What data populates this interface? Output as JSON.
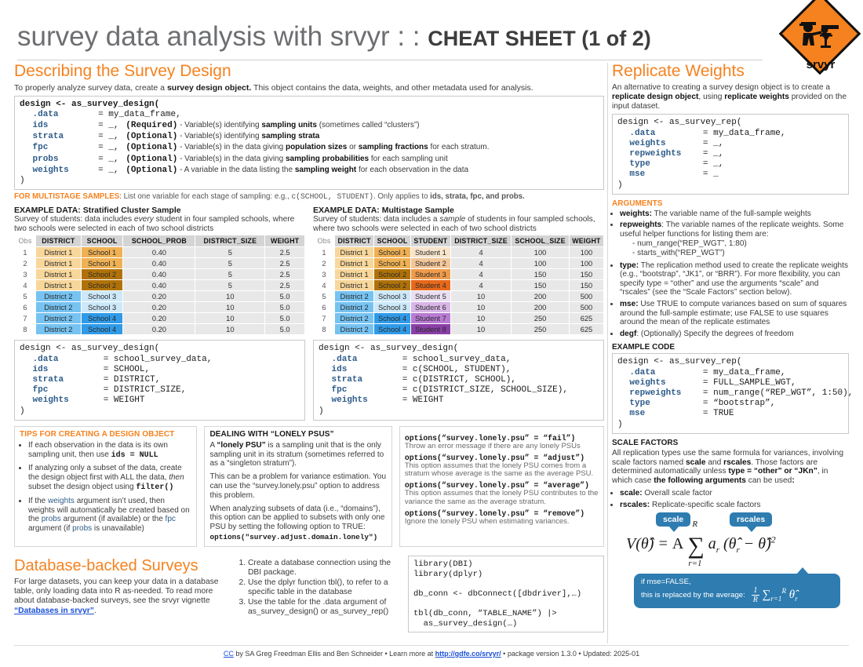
{
  "header": {
    "title_main": "survey data analysis with srvyr : : ",
    "title_bold": "CHEAT SHEET (1 of 2)",
    "logo_text": "srvyr",
    "logo_icon": "surveyor-transit-icon"
  },
  "design_section": {
    "heading": "Describing the Survey Design",
    "intro_a": "To properly analyze survey data, create a ",
    "intro_b": "survey design object.",
    "intro_c": " This object contains the data, weights, and other metadata used for analysis.",
    "code": {
      "line0": "design <- as_survey_design(",
      "rows": [
        {
          "arg": ".data",
          "eq": "= my_data_frame,",
          "req": "",
          "desc": ""
        },
        {
          "arg": "ids",
          "eq": "= _,",
          "req": "(Required)",
          "desc": " - Variable(s) identifying ",
          "b1": "sampling units",
          "tail": " (sometimes called “clusters”)"
        },
        {
          "arg": "strata",
          "eq": "= _,",
          "req": "(Optional)",
          "desc": " - Variable(s) identifying ",
          "b1": "sampling strata",
          "tail": ""
        },
        {
          "arg": "fpc",
          "eq": "= _,",
          "req": "(Optional)",
          "desc": " - Variable(s) in the data giving ",
          "b1": "population sizes",
          "mid": " or ",
          "b2": "sampling fractions",
          "tail": " for each stratum."
        },
        {
          "arg": "probs",
          "eq": "= _,",
          "req": "(Optional)",
          "desc": " - Variable(s) in the data giving ",
          "b1": "sampling probabilities",
          "tail": " for each sampling unit"
        },
        {
          "arg": "weights",
          "eq": "= _,",
          "req": "(Optional)",
          "desc": " - A variable in the data listing the ",
          "b1": "sampling weight",
          "tail": " for each observation in the data"
        }
      ],
      "close": ")"
    },
    "multistage_label": "FOR MULTISTAGE SAMPLES",
    "multistage_text_a": ": List one variable for each stage of sampling: e.g., ",
    "multistage_code": "c(SCHOOL, STUDENT)",
    "multistage_text_b": ". Only applies to ",
    "multistage_args": "ids, strata, fpc, and probs."
  },
  "example_stratified": {
    "heading_a": "EXAMPLE DATA: ",
    "heading_b": "Stratified Cluster Sample",
    "sub_a": "Survey of students: data includes ",
    "sub_i": "every",
    "sub_b": " student in four sampled schools, where two schools were selected in each of two school districts",
    "columns": [
      "Obs",
      "DISTRICT",
      "SCHOOL",
      "SCHOOL_PROB",
      "DISTRICT_SIZE",
      "WEIGHT"
    ],
    "rows": [
      {
        "obs": "1",
        "district": "District 1",
        "school": "School 1",
        "school_prob": "0.40",
        "district_size": "5",
        "weight": "2.5",
        "d_color": "#F8D79B",
        "s_color": "#EFB153"
      },
      {
        "obs": "2",
        "district": "District 1",
        "school": "School 1",
        "school_prob": "0.40",
        "district_size": "5",
        "weight": "2.5",
        "d_color": "#F8D79B",
        "s_color": "#EFB153"
      },
      {
        "obs": "3",
        "district": "District 1",
        "school": "School 2",
        "school_prob": "0.40",
        "district_size": "5",
        "weight": "2.5",
        "d_color": "#F8D79B",
        "s_color": "#B07208"
      },
      {
        "obs": "4",
        "district": "District 1",
        "school": "School 2",
        "school_prob": "0.40",
        "district_size": "5",
        "weight": "2.5",
        "d_color": "#F8D79B",
        "s_color": "#B07208"
      },
      {
        "obs": "5",
        "district": "District 2",
        "school": "School 3",
        "school_prob": "0.20",
        "district_size": "10",
        "weight": "5.0",
        "d_color": "#76C3F2",
        "s_color": "#CCE8F9"
      },
      {
        "obs": "6",
        "district": "District 2",
        "school": "School 3",
        "school_prob": "0.20",
        "district_size": "10",
        "weight": "5.0",
        "d_color": "#76C3F2",
        "s_color": "#CCE8F9"
      },
      {
        "obs": "7",
        "district": "District 2",
        "school": "School 4",
        "school_prob": "0.20",
        "district_size": "10",
        "weight": "5.0",
        "d_color": "#76C3F2",
        "s_color": "#2F9BE8"
      },
      {
        "obs": "8",
        "district": "District 2",
        "school": "School 4",
        "school_prob": "0.20",
        "district_size": "10",
        "weight": "5.0",
        "d_color": "#76C3F2",
        "s_color": "#2F9BE8"
      }
    ],
    "code": {
      "line0": "design <- as_survey_design(",
      "rows": [
        {
          "arg": ".data",
          "val": "= school_survey_data,"
        },
        {
          "arg": "ids",
          "val": "= SCHOOL,"
        },
        {
          "arg": "strata",
          "val": "= DISTRICT,"
        },
        {
          "arg": "fpc",
          "val": "= DISTRICT_SIZE,"
        },
        {
          "arg": "weights",
          "val": "= WEIGHT"
        }
      ],
      "close": ")"
    }
  },
  "example_multistage": {
    "heading_a": "EXAMPLE DATA: ",
    "heading_b": "Multistage Sample",
    "sub_a": "Survey of students: data includes a ",
    "sub_i": "sample",
    "sub_b": " of students in four sampled schools, where two schools were selected in each of two school districts",
    "columns": [
      "Obs",
      "DISTRICT",
      "SCHOOL",
      "STUDENT",
      "DISTRICT_SIZE",
      "SCHOOL_SIZE",
      "WEIGHT"
    ],
    "rows": [
      {
        "obs": "1",
        "district": "District 1",
        "school": "School 1",
        "student": "Student 1",
        "district_size": "4",
        "school_size": "100",
        "weight": "100",
        "d_color": "#F8D79B",
        "s_color": "#EFB153",
        "t_color": "#F7E4CB"
      },
      {
        "obs": "2",
        "district": "District 1",
        "school": "School 1",
        "student": "Student 2",
        "district_size": "4",
        "school_size": "100",
        "weight": "100",
        "d_color": "#F8D79B",
        "s_color": "#EFB153",
        "t_color": "#F3C79A"
      },
      {
        "obs": "3",
        "district": "District 1",
        "school": "School 2",
        "student": "Student 3",
        "district_size": "4",
        "school_size": "150",
        "weight": "150",
        "d_color": "#F8D79B",
        "s_color": "#B07208",
        "t_color": "#F09B4A"
      },
      {
        "obs": "4",
        "district": "District 1",
        "school": "School 2",
        "student": "Student 4",
        "district_size": "4",
        "school_size": "150",
        "weight": "150",
        "d_color": "#F8D79B",
        "s_color": "#B07208",
        "t_color": "#E8681A"
      },
      {
        "obs": "5",
        "district": "District 2",
        "school": "School 3",
        "student": "Student 5",
        "district_size": "10",
        "school_size": "200",
        "weight": "500",
        "d_color": "#76C3F2",
        "s_color": "#CCE8F9",
        "t_color": "#EADEF2"
      },
      {
        "obs": "6",
        "district": "District 2",
        "school": "School 3",
        "student": "Student 6",
        "district_size": "10",
        "school_size": "200",
        "weight": "500",
        "d_color": "#76C3F2",
        "s_color": "#CCE8F9",
        "t_color": "#D9B6E8"
      },
      {
        "obs": "7",
        "district": "District 2",
        "school": "School 4",
        "student": "Student 7",
        "district_size": "10",
        "school_size": "250",
        "weight": "625",
        "d_color": "#76C3F2",
        "s_color": "#2F9BE8",
        "t_color": "#B97AD4"
      },
      {
        "obs": "8",
        "district": "District 2",
        "school": "School 4",
        "student": "Student 8",
        "district_size": "10",
        "school_size": "250",
        "weight": "625",
        "d_color": "#76C3F2",
        "s_color": "#2F9BE8",
        "t_color": "#8B3FA8"
      }
    ],
    "code": {
      "line0": "design <- as_survey_design(",
      "rows": [
        {
          "arg": ".data",
          "val": "= school_survey_data,"
        },
        {
          "arg": "ids",
          "val": "= c(SCHOOL, STUDENT),"
        },
        {
          "arg": "strata",
          "val": "= c(DISTRICT, SCHOOL),"
        },
        {
          "arg": "fpc",
          "val": "= c(DISTRICT_SIZE, SCHOOL_SIZE),"
        },
        {
          "arg": "weights",
          "val": "= WEIGHT"
        }
      ],
      "close": ")"
    }
  },
  "tips": {
    "heading": "TIPS FOR CREATING A DESIGN OBJECT",
    "items": [
      {
        "a": "If each observation in the data is its own sampling unit, then use ",
        "code": "ids = NULL",
        "b": ""
      },
      {
        "a": "If analyzing only a subset of the data, create the design object first with ALL the data, ",
        "i": "then",
        "b2": " subset the design object using ",
        "code": "filter()"
      },
      {
        "a2": "If the ",
        "blue1": "weights",
        "mid1": " argument isn’t used, then weights will automatically be created based on the ",
        "blue2": "probs",
        "mid2": " argument (if available) or the ",
        "blue3": "fpc",
        "mid3": " argument (if ",
        "blue4": "probs",
        "mid4": " is unavailable)"
      }
    ]
  },
  "lonely": {
    "heading": "DEALING WITH “LONELY PSUS”",
    "p1_a": "A ",
    "p1_b": "“lonely PSU”",
    "p1_c": " is a sampling unit that is the only sampling unit in its stratum (sometimes referred to as a “singleton stratum”).",
    "p2": "This can be a problem for variance estimation. You can use the “survey.lonely.psu” option to address this problem.",
    "p3": "When analyzing subsets of data (i.e., “domains”), this option can be applied to subsets with only one PSU by setting the following option to TRUE:",
    "p3_code": "options(\"survey.adjust.domain.lonely\")",
    "options": [
      {
        "code": "options(“survey.lonely.psu” = “fail”)",
        "desc": "Throw an error message if there are any lonely PSUs"
      },
      {
        "code": "options(“survey.lonely.psu” = “adjust”)",
        "desc": "This option assumes that the lonely PSU comes from a stratum whose average is the same as the average PSU."
      },
      {
        "code": "options(“survey.lonely.psu” = “average”)",
        "desc": "This option assumes that the lonely PSU contributes to the variance the same as the average stratum."
      },
      {
        "code": "options(“survey.lonely.psu” = “remove”)",
        "desc": "Ignore the lonely PSU when estimating variances."
      }
    ]
  },
  "database": {
    "heading": "Database-backed Surveys",
    "text_a": "For large datasets, you can keep your data in a database table, only loading data into R as-needed. To read more about database-backed surveys, see the srvyr vignette ",
    "link": "“Databases in srvyr”",
    "text_b": ".",
    "steps": [
      "Create a database connection using the DBI package.",
      "Use the dplyr function tbl(), to refer to a specific table in the database",
      "Use the table for the .data argument of as_survey_design() or as_survey_rep()"
    ],
    "code": "library(DBI)\nlibrary(dplyr)\n\ndb_conn <- dbConnect([dbdriver],…)\n\ntbl(db_conn, “TABLE_NAME”) |>\n  as_survey_design(…)"
  },
  "replicate": {
    "heading": "Replicate Weights",
    "intro_a": "An alternative to creating a survey design object is to create a ",
    "intro_b": "replicate design object",
    "intro_c": ", using ",
    "intro_d": "replicate weights",
    "intro_e": " provided on the input dataset.",
    "code": {
      "line0": "design <- as_survey_rep(",
      "rows": [
        {
          "arg": ".data",
          "val": "= my_data_frame,"
        },
        {
          "arg": "weights",
          "val": "= _,"
        },
        {
          "arg": "repweights",
          "val": "= _,"
        },
        {
          "arg": "type",
          "val": "= _,"
        },
        {
          "arg": "mse",
          "val": "= _"
        }
      ],
      "close": ")"
    },
    "args_heading": "ARGUMENTS",
    "args": [
      {
        "name": "weights:",
        "text": " The variable name of the full-sample weights"
      },
      {
        "name": "repweights",
        "text": ": The variable names of the replicate weights. Some useful helper functions for listing them are:",
        "sub": [
          "- num_range(“REP_WGT”, 1:80)",
          "- starts_with(“REP_WGT”)"
        ]
      },
      {
        "name": "type:",
        "text": " The replication method used to create the replicate weights (e.g., “bootstrap”, “JK1”, or “BRR”). For more flexibility, you can specify type = “other” and use the arguments “scale” and “rscales” (see the “Scale Factors” section below)."
      },
      {
        "name": "mse:",
        "text": " Use TRUE to compute variances based on sum of squares around the full-sample estimate; use FALSE to use squares around the mean of the replicate estimates"
      },
      {
        "name": "degf",
        "text": ": (Optionally) Specify the degrees of freedom"
      }
    ],
    "example_heading": "EXAMPLE CODE",
    "example_code": {
      "line0": "design <- as_survey_rep(",
      "rows": [
        {
          "arg": ".data",
          "val": "= my_data_frame,"
        },
        {
          "arg": "weights",
          "val": "= FULL_SAMPLE_WGT,"
        },
        {
          "arg": "repweights",
          "val": "= num_range(“REP_WGT”, 1:50),"
        },
        {
          "arg": "type",
          "val": "= “bootstrap”,"
        },
        {
          "arg": "mse",
          "val": "= TRUE"
        }
      ],
      "close": ")"
    },
    "scale_heading": "SCALE FACTORS",
    "scale_text_a": "All replication types use the same formula for variances, involving scale factors named ",
    "scale_text_b": "scale",
    "scale_text_c": " and ",
    "scale_text_d": "rscales",
    "scale_text_e": ". Those factors are determined automatically unless ",
    "scale_text_f": "type = “other” or “JKn”",
    "scale_text_g": ", in which case ",
    "scale_text_h": "the following arguments",
    "scale_text_i": " can be used",
    "scale_bullets": [
      {
        "name": "scale:",
        "text": " Overall scale factor"
      },
      {
        "name": "rscales:",
        "text": " Replicate-specific scale factors"
      }
    ],
    "formula": {
      "bubble_scale": "scale",
      "bubble_rscales": "rscales",
      "equation": "V(θ̂) = A ∑ aᵣ (θ̂ᵣ − θ̂)²",
      "sum_upper": "R",
      "sum_lower": "r=1",
      "note_a": "if mse=FALSE,",
      "note_b": "this is replaced by the average:",
      "note_math": "1/R ∑ᵣ₌₁ᴿ θ̂ᵣ"
    }
  },
  "footer": {
    "cc": "CC",
    "by": " by SA Greg Freedman Ellis and Ben Schneider",
    "sep1": " • Learn more at ",
    "url": "http://gdfe.co/srvyr/",
    "sep2": " • package version ",
    "version": "1.3.0",
    "sep3": " • Updated: ",
    "updated": "2025-01"
  }
}
